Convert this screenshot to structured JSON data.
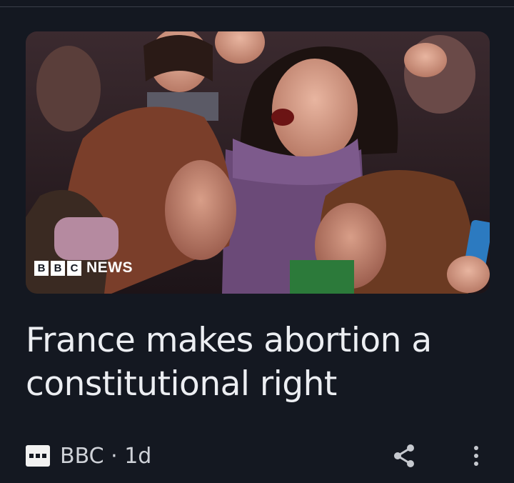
{
  "article": {
    "headline": "France makes abortion a constitutional right",
    "image_alt": "Women celebrating and embracing in a crowd",
    "image_overlay": {
      "blocks": [
        "B",
        "B",
        "C"
      ],
      "word": "NEWS"
    },
    "publisher": "BBC",
    "age": "1d",
    "meta_text": "BBC · 1d"
  },
  "actions": {
    "share_icon": "share-icon",
    "more_icon": "more-vertical-icon"
  },
  "colors": {
    "background": "#141821",
    "headline": "#eceef2",
    "meta": "#cfd2d8",
    "icon": "#c6c9cf"
  }
}
